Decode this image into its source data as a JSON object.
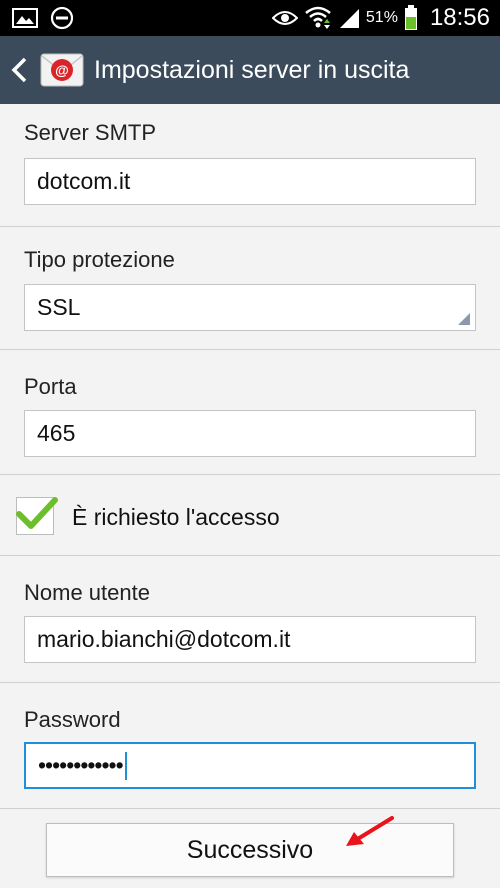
{
  "status_bar": {
    "battery_percent": "51%",
    "time": "18:56",
    "icons": [
      "image-icon",
      "do-not-disturb-icon",
      "eye-icon",
      "wifi-icon",
      "signal-icon",
      "battery-icon"
    ]
  },
  "action_bar": {
    "title": "Impostazioni server in uscita",
    "back_icon": "chevron-left-icon",
    "app_icon": "email-app-icon"
  },
  "form": {
    "smtp": {
      "label": "Server SMTP",
      "value": "dotcom.it"
    },
    "protection": {
      "label": "Tipo protezione",
      "value": "SSL"
    },
    "port": {
      "label": "Porta",
      "value": "465"
    },
    "login_required": {
      "label": "È richiesto l'accesso",
      "checked": true
    },
    "username": {
      "label": "Nome utente",
      "value": "mario.bianchi@dotcom.it"
    },
    "password": {
      "label": "Password",
      "value": "••••••••••••"
    }
  },
  "next_button": {
    "label": "Successivo"
  },
  "colors": {
    "action_bar": "#3b4b5b",
    "focus": "#1e90d6",
    "check": "#6cbf2b",
    "arrow": "#e8141a"
  }
}
